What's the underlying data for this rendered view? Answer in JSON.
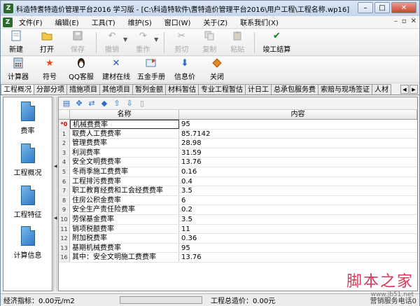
{
  "window": {
    "title": "科造特耆特造价管理平台2016 学习版 - [C:\\科造特软件\\耆特造价管理平台2016\\用户工程\\工程名称.wp16]"
  },
  "menu": [
    "文件(F)",
    "编辑(E)",
    "工具(T)",
    "维护(S)",
    "窗口(W)",
    "关于(Z)",
    "联系我们(X)"
  ],
  "toolbar1": [
    {
      "label": "新建",
      "icon": "new-document-icon",
      "enabled": true
    },
    {
      "label": "打开",
      "icon": "open-folder-icon",
      "enabled": true
    },
    {
      "label": "保存",
      "icon": "save-disk-icon",
      "enabled": false
    },
    {
      "label": "撤销",
      "icon": "undo-icon",
      "enabled": false
    },
    {
      "label": "重作",
      "icon": "redo-icon",
      "enabled": false
    },
    {
      "label": "剪切",
      "icon": "scissors-icon",
      "enabled": false
    },
    {
      "label": "复制",
      "icon": "copy-icon",
      "enabled": false
    },
    {
      "label": "粘贴",
      "icon": "paste-icon",
      "enabled": false
    },
    {
      "label": "竣工结算",
      "icon": "checkmark-icon",
      "enabled": true
    }
  ],
  "toolbar2": [
    {
      "label": "计算器",
      "icon": "calculator-icon"
    },
    {
      "label": "符号",
      "icon": "star-icon"
    },
    {
      "label": "QQ客服",
      "icon": "penguin-icon"
    },
    {
      "label": "建材在线",
      "icon": "cross-tools-icon"
    },
    {
      "label": "五金手册",
      "icon": "manual-icon"
    },
    {
      "label": "信息价",
      "icon": "down-arrow-icon"
    },
    {
      "label": "关闭",
      "icon": "close-icon"
    }
  ],
  "tabs": [
    "工程概况",
    "分部分项",
    "措施项目",
    "其他项目",
    "暂列金额",
    "材料暂估",
    "专业工程暂估",
    "计日工",
    "总承包服务费",
    "索赔与现场签证",
    "人材"
  ],
  "nav": [
    "费率",
    "工程概况",
    "工程特征",
    "计算信息"
  ],
  "grid": {
    "headers": [
      "名称",
      "内容"
    ],
    "rows": [
      {
        "no": "*0",
        "name": "机械费费率",
        "value": "95"
      },
      {
        "no": "1",
        "name": "取费人工费费率",
        "value": "85.7142"
      },
      {
        "no": "2",
        "name": "管理费费率",
        "value": "28.98"
      },
      {
        "no": "3",
        "name": "利润费率",
        "value": "31.59"
      },
      {
        "no": "4",
        "name": "安全文明费费率",
        "value": "13.76"
      },
      {
        "no": "5",
        "name": "冬雨季施工费费率",
        "value": "0.16"
      },
      {
        "no": "6",
        "name": "工程排污费费率",
        "value": "0.4"
      },
      {
        "no": "7",
        "name": "职工教育经费和工会经费费率",
        "value": "3.5"
      },
      {
        "no": "8",
        "name": "住房公积金费率",
        "value": "6"
      },
      {
        "no": "9",
        "name": "安全生产责任险费率",
        "value": "0.2"
      },
      {
        "no": "10",
        "name": "劳保基金费率",
        "value": "3.5"
      },
      {
        "no": "11",
        "name": "销项税额费率",
        "value": "11"
      },
      {
        "no": "12",
        "name": "附加税费率",
        "value": "0.36"
      },
      {
        "no": "13",
        "name": "基期机械费费率",
        "value": "95"
      },
      {
        "no": "16",
        "name": "其中：安全文明施工费费率",
        "value": "13.76"
      }
    ]
  },
  "status": {
    "left": "经济指标：0.00元/m2",
    "middle": "工程总造价：0.00元",
    "right": "营销服务电话0"
  },
  "watermark": {
    "main": "脚本之家",
    "sub": "www.jb51.net"
  }
}
